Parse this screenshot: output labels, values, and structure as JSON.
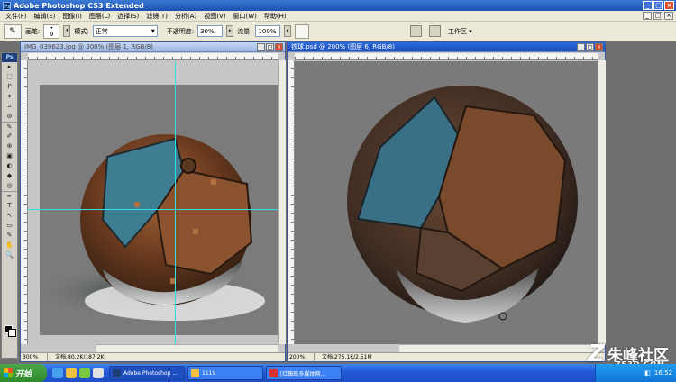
{
  "app": {
    "title": "Adobe Photoshop CS3 Extended",
    "badge": "Ps",
    "window_buttons": [
      "_",
      "□",
      "×"
    ]
  },
  "menu": {
    "items": [
      "文件(F)",
      "编辑(E)",
      "图像(I)",
      "图层(L)",
      "选择(S)",
      "滤镜(T)",
      "分析(A)",
      "视图(V)",
      "窗口(W)",
      "帮助(H)"
    ]
  },
  "options": {
    "brush_label": "画笔:",
    "brush_size": "9",
    "mode_label": "模式:",
    "mode_value": "正常",
    "opacity_label": "不透明度:",
    "opacity_value": "30%",
    "flow_label": "流量:",
    "flow_value": "100%",
    "workspace_label": "工作区 ▾"
  },
  "toolbox": {
    "logo": "Ps",
    "tools": [
      "▸",
      "⬚",
      "ᑭ",
      "✦",
      "⌗",
      "⊘",
      "✎",
      "✐",
      "⊕",
      "▣",
      "◐",
      "◆",
      "◎",
      "✒",
      "T",
      "↖",
      "▭",
      "✎",
      "✋",
      "🔍"
    ],
    "icons": [
      "move-tool-icon",
      "marquee-tool-icon",
      "lasso-tool-icon",
      "magic-wand-icon",
      "crop-tool-icon",
      "slice-tool-icon",
      "healing-brush-icon",
      "brush-tool-icon",
      "clone-stamp-icon",
      "history-brush-icon",
      "eraser-icon",
      "gradient-icon",
      "blur-tool-icon",
      "pen-tool-icon",
      "type-tool-icon",
      "path-select-icon",
      "shape-tool-icon",
      "notes-icon",
      "hand-tool-icon",
      "zoom-tool-icon"
    ]
  },
  "doc_left": {
    "title": "IMG_039623.jpg @ 300% (图层 1, RGB/8)",
    "zoom": "300%",
    "status": "文档:80.2K/187.2K"
  },
  "doc_right": {
    "title": "铁球.psd @ 200% (图层 6, RGB/8)",
    "zoom": "200%",
    "status": "文档:275.1K/2.51M"
  },
  "taskbar": {
    "start": "开始",
    "items": [
      "Adobe Photoshop ...",
      "1119",
      "[红蜘蛛多媒体网..."
    ],
    "time": "16:52"
  },
  "watermark": {
    "main": "朱峰社区",
    "sub": "ZF3D.COM"
  },
  "colors": {
    "guide": "#2fe0e6",
    "xp_blue": "#245ad8",
    "canvas_gray": "#7a7a7a"
  }
}
